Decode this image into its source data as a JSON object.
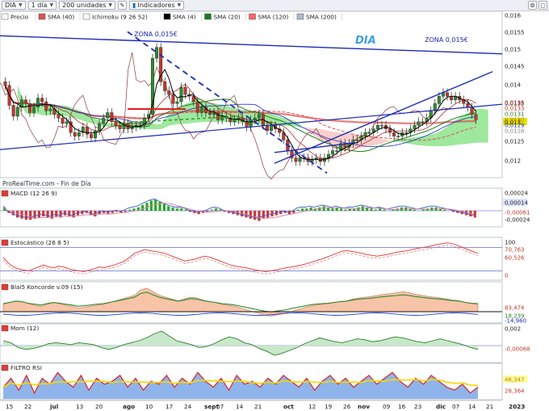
{
  "toolbar": {
    "symbol": "DIA",
    "interval": "1 día",
    "units": "200 unidades",
    "indicators": "Indicadores"
  },
  "colors": {
    "up": "#2e8b2e",
    "down": "#c0392b",
    "sma40": "#d9534f",
    "sma4": "#000000",
    "sma20": "#1f7a1f",
    "sma120": "#ff6666",
    "sma200": "#b0b8c8",
    "trend": "#1a2bb8",
    "cloud_pos": "#4cd64c",
    "cloud_neg": "#f4a6a0"
  },
  "chart_data": [
    {
      "type": "line",
      "panel": "price",
      "legend": [
        "Precio",
        "SMA (40)",
        "Ichimoku (9 26 52)",
        "SMA (4)",
        "SMA (20)",
        "SMA (120)",
        "SMA (200)"
      ],
      "annotations": [
        "ZONA 0,015€",
        "DIA",
        "ZONA 0,015€",
        "ProRealTime.com - Fin de Día"
      ],
      "y_ticks": [
        "0,016",
        "0,0155",
        "0,015",
        "0,0145",
        "0,014",
        "0,0135",
        "0,013",
        "0,0125",
        "0,012"
      ],
      "last_value": "0,013",
      "right_labels": [
        "0,0135",
        "0,0133",
        "0,0131",
        "0,0130",
        "0,0129",
        "0,0128"
      ],
      "ylim": [
        0.0117,
        0.0162
      ],
      "close": [
        0.0142,
        0.01365,
        0.01335,
        0.0136,
        0.0138,
        0.0137,
        0.01345,
        0.0136,
        0.01385,
        0.01375,
        0.0135,
        0.01355,
        0.0134,
        0.0133,
        0.01315,
        0.0132,
        0.0129,
        0.0128,
        0.0129,
        0.01305,
        0.01285,
        0.01275,
        0.01295,
        0.01315,
        0.0133,
        0.01345,
        0.0132,
        0.0131,
        0.013,
        0.01315,
        0.013,
        0.01305,
        0.0131,
        0.0131,
        0.0133,
        0.0134,
        0.01495,
        0.01525,
        0.0143,
        0.01405,
        0.01395,
        0.0137,
        0.01375,
        0.01415,
        0.01395,
        0.0139,
        0.01375,
        0.01345,
        0.0136,
        0.01345,
        0.0134,
        0.01345,
        0.01325,
        0.01335,
        0.0133,
        0.0132,
        0.01325,
        0.0133,
        0.0132,
        0.01305,
        0.01325,
        0.0133,
        0.0134,
        0.0131,
        0.01295,
        0.0131,
        0.013,
        0.0129,
        0.0127,
        0.0124,
        0.0122,
        0.0121,
        0.0122,
        0.0122,
        0.0121,
        0.01215,
        0.0122,
        0.0121,
        0.0122,
        0.0123,
        0.0124,
        0.0124,
        0.0126,
        0.0125,
        0.0126,
        0.0127,
        0.0127,
        0.0128,
        0.0129,
        0.0129,
        0.013,
        0.0131,
        0.0131,
        0.013,
        0.0129,
        0.0128,
        0.0128,
        0.0129,
        0.0129,
        0.013,
        0.0131,
        0.0132,
        0.0132,
        0.0133,
        0.0135,
        0.0137,
        0.0139,
        0.014,
        0.0139,
        0.0138,
        0.0139,
        0.0138,
        0.0137,
        0.0136,
        0.0134,
        0.01325
      ]
    },
    {
      "type": "bar",
      "panel": "macd",
      "legend": [
        "MACD (12 26 9)"
      ],
      "y_ticks": [
        "0,00024",
        "0,00014",
        "-0,00061",
        "-0,00024"
      ],
      "values": [
        0.3,
        -0.2,
        -0.4,
        -0.6,
        -0.7,
        -0.8,
        -0.8,
        -0.7,
        -0.6,
        -0.5,
        -0.6,
        -0.7,
        -0.5,
        -0.6,
        -0.4,
        -0.5,
        -0.6,
        -0.4,
        -0.3,
        -0.2,
        -0.4,
        -0.5,
        -0.3,
        -0.2,
        -0.3,
        -0.2,
        -0.1,
        -0.2,
        -0.1,
        0.1,
        0.2,
        0.3,
        0.5,
        0.7,
        0.9,
        1.0,
        0.8,
        0.6,
        0.4,
        0.3,
        0.2,
        0.2,
        0.1,
        -0.1,
        -0.2,
        -0.3,
        -0.2,
        -0.1,
        0.1,
        0.2,
        0.1,
        -0.1,
        -0.2,
        -0.3,
        -0.4,
        -0.5,
        -0.6,
        -0.7,
        -0.8,
        -0.9,
        -0.7,
        -0.6,
        -0.5,
        -0.4,
        -0.3,
        -0.2,
        -0.3,
        -0.2,
        0.1,
        0.2,
        0.2,
        0.3,
        0.2,
        0.3,
        0.4,
        0.3,
        0.2,
        0.3,
        0.2,
        0.1,
        0.2,
        0.2,
        0.3,
        0.4,
        0.3,
        0.2,
        0.1,
        0.2,
        0.1,
        0.0,
        0.1,
        0.2,
        0.3,
        0.3,
        0.2,
        0.1,
        0.0,
        0.1,
        0.2,
        0.3,
        0.3,
        0.2,
        0.1,
        0.0,
        -0.1,
        -0.2,
        -0.3,
        -0.4,
        -0.5,
        -0.6
      ]
    },
    {
      "type": "line",
      "panel": "stoch",
      "legend": [
        "Estocástico (26 8 5)"
      ],
      "y_ticks": [
        "100",
        "70,763",
        "60,526",
        "0"
      ],
      "values": [
        55,
        40,
        30,
        25,
        22,
        20,
        25,
        30,
        35,
        30,
        28,
        32,
        30,
        25,
        22,
        20,
        18,
        22,
        25,
        30,
        28,
        32,
        35,
        40,
        45,
        55,
        65,
        70,
        75,
        72,
        70,
        68,
        65,
        60,
        55,
        50,
        45,
        48,
        50,
        55,
        58,
        55,
        50,
        45,
        40,
        35,
        32,
        30,
        28,
        25,
        22,
        20,
        18,
        20,
        22,
        25,
        28,
        30,
        32,
        35,
        38,
        42,
        46,
        50,
        55,
        60,
        65,
        70,
        72,
        70,
        68,
        65,
        62,
        60,
        58,
        60,
        62,
        65,
        68,
        70,
        72,
        75,
        78,
        80,
        82,
        85,
        88,
        90,
        92,
        90,
        85,
        80,
        75,
        70,
        65
      ]
    },
    {
      "type": "area",
      "panel": "koncorde",
      "legend": [
        "Blai5 Koncorde v.09 (15)"
      ],
      "y_ticks": [
        "83,474",
        "18,239",
        "-14,960"
      ],
      "values": [
        20,
        25,
        30,
        28,
        22,
        18,
        15,
        20,
        25,
        22,
        18,
        15,
        10,
        12,
        15,
        18,
        20,
        25,
        30,
        35,
        40,
        45,
        60,
        65,
        55,
        45,
        40,
        35,
        30,
        35,
        40,
        38,
        32,
        28,
        25,
        20,
        18,
        15,
        10,
        5,
        0,
        -5,
        -10,
        -12,
        -8,
        -5,
        0,
        5,
        10,
        15,
        18,
        20,
        22,
        25,
        28,
        30,
        35,
        38,
        40,
        42,
        45,
        48,
        50,
        52,
        55,
        52,
        48,
        45,
        42,
        40,
        38,
        35,
        32,
        30,
        25,
        22,
        20
      ]
    },
    {
      "type": "line",
      "panel": "mom",
      "legend": [
        "Mom (12)"
      ],
      "y_ticks": [
        "0,002",
        "-0,00068"
      ],
      "values": [
        0.5,
        0.3,
        -0.2,
        -0.4,
        -0.3,
        -0.1,
        0.2,
        0.3,
        0.2,
        0.1,
        0.3,
        0.2,
        0.1,
        -0.2,
        -0.4,
        -0.2,
        0.1,
        0.3,
        0.5,
        0.8,
        1.2,
        1.5,
        1.0,
        0.5,
        0.3,
        0.1,
        -0.2,
        -0.1,
        0.2,
        0.6,
        0.9,
        0.7,
        0.3,
        0.1,
        -0.3,
        -0.6,
        -1.0,
        -0.8,
        -0.5,
        -0.2,
        0.2,
        0.5,
        0.8,
        0.6,
        0.4,
        0.3,
        0.5,
        0.7,
        0.6,
        0.4,
        0.5,
        0.7,
        0.9,
        0.8,
        0.6,
        0.4,
        0.3,
        0.5,
        0.7,
        0.5,
        0.3,
        0.1,
        -0.2,
        -0.4
      ]
    },
    {
      "type": "line",
      "panel": "filtro_rsi",
      "legend": [
        "FILTRO RSI"
      ],
      "y_ticks": [
        "46,347",
        "28,364"
      ],
      "values": [
        40,
        55,
        35,
        60,
        30,
        55,
        45,
        65,
        50,
        40,
        60,
        35,
        55,
        45,
        50,
        60,
        40,
        55,
        35,
        50,
        45,
        60,
        40,
        55,
        45,
        65,
        50,
        40,
        55,
        35,
        60,
        45,
        50,
        40,
        55,
        45,
        60,
        50,
        40,
        55,
        35,
        50,
        60,
        45,
        55,
        40,
        50,
        60,
        45,
        55,
        65,
        50,
        40,
        55,
        45,
        60,
        50,
        40,
        35,
        45,
        30,
        40
      ]
    }
  ],
  "x_axis_labels": [
    "15",
    "22",
    "jul",
    "13",
    "20",
    "ago",
    "10",
    "17",
    "24",
    "sept",
    "07",
    "14",
    "21",
    "oct",
    "12",
    "19",
    "26",
    "nov",
    "09",
    "16",
    "23",
    "dic",
    "07",
    "14",
    "21",
    "2023"
  ]
}
